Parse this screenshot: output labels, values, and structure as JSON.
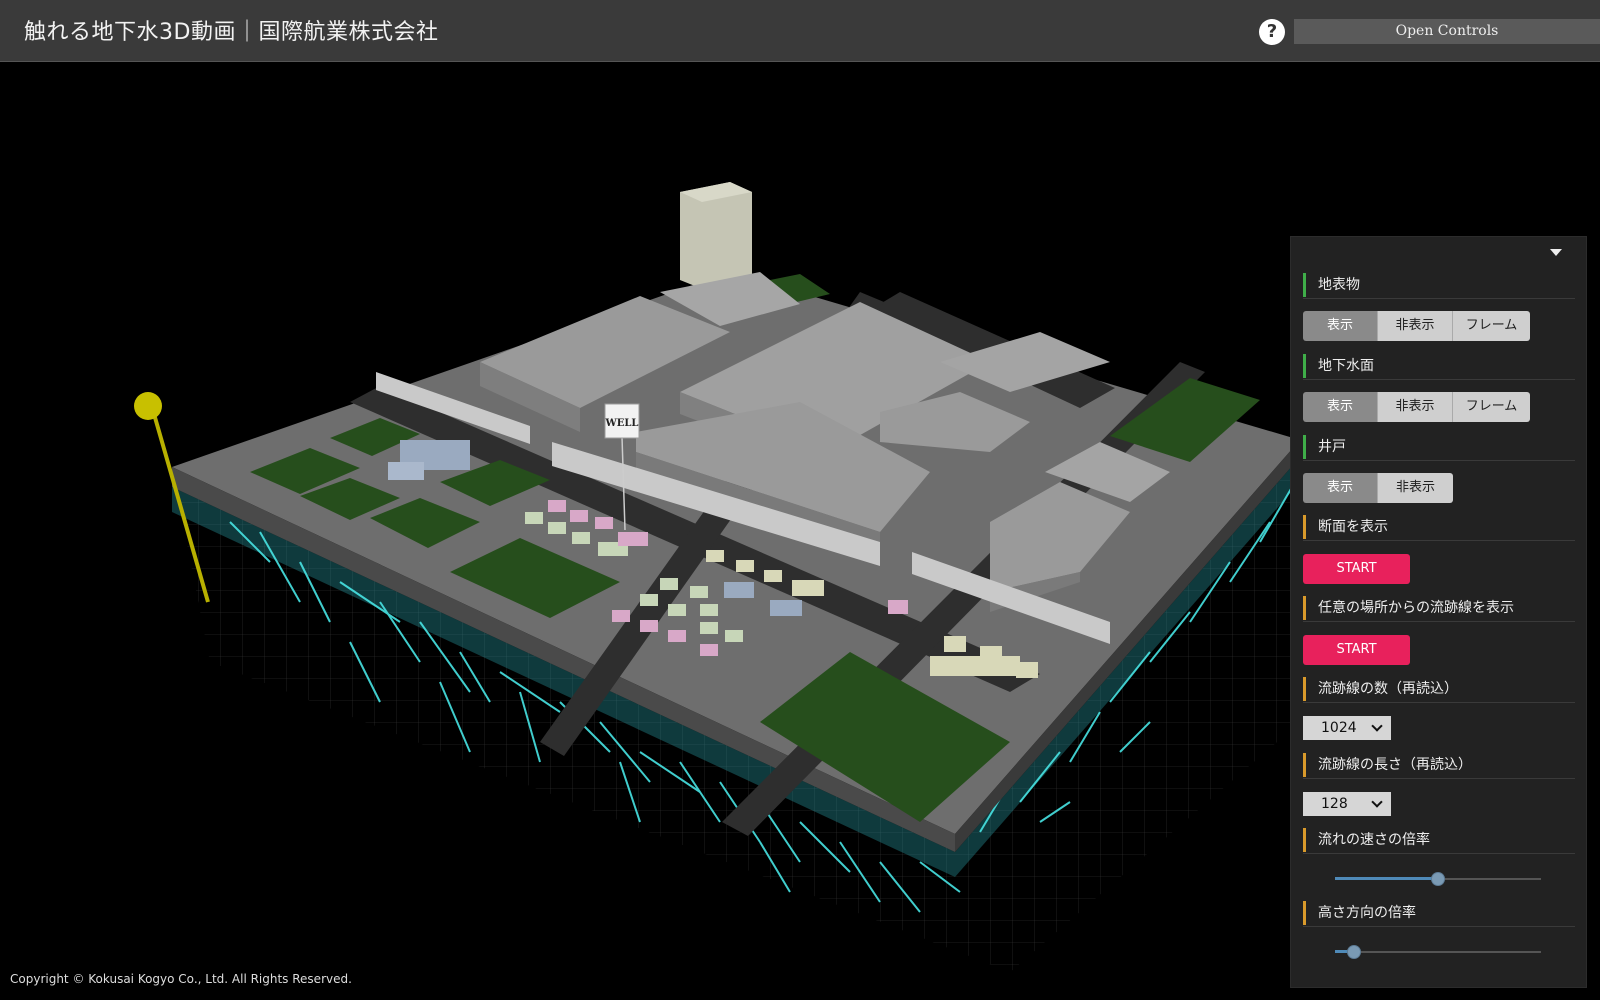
{
  "header": {
    "title": "触れる地下水3D動画｜国際航業株式会社",
    "help_label": "?",
    "open_controls_label": "Open Controls"
  },
  "scene": {
    "well_sign": "WELL"
  },
  "footer": {
    "copyright": "Copyright © Kokusai Kogyo Co., Ltd. All Rights Reserved."
  },
  "panel": {
    "sections": {
      "surface": {
        "label": "地表物",
        "buttons": [
          "表示",
          "非表示",
          "フレーム"
        ],
        "selected": "表示"
      },
      "water_table": {
        "label": "地下水面",
        "buttons": [
          "表示",
          "非表示",
          "フレーム"
        ],
        "selected": "表示"
      },
      "well": {
        "label": "井戸",
        "buttons": [
          "表示",
          "非表示"
        ],
        "selected": "表示"
      },
      "cross_section": {
        "label": "断面を表示",
        "button": "START"
      },
      "streamline_any": {
        "label": "任意の場所からの流跡線を表示",
        "button": "START"
      },
      "streamline_count": {
        "label": "流跡線の数（再読込）",
        "value": "1024"
      },
      "streamline_length": {
        "label": "流跡線の長さ（再読込）",
        "value": "128"
      },
      "flow_speed": {
        "label": "流れの速さの倍率",
        "level": 0.5
      },
      "height_scale": {
        "label": "高さ方向の倍率",
        "level": 0.09
      }
    }
  },
  "colors": {
    "header_bg": "#3a3a3a",
    "panel_bg": "#222222",
    "start_button": "#e8215c",
    "green_bar": "#3fae49",
    "orange_bar": "#d99a2b",
    "streamline": "#48e4e4"
  }
}
